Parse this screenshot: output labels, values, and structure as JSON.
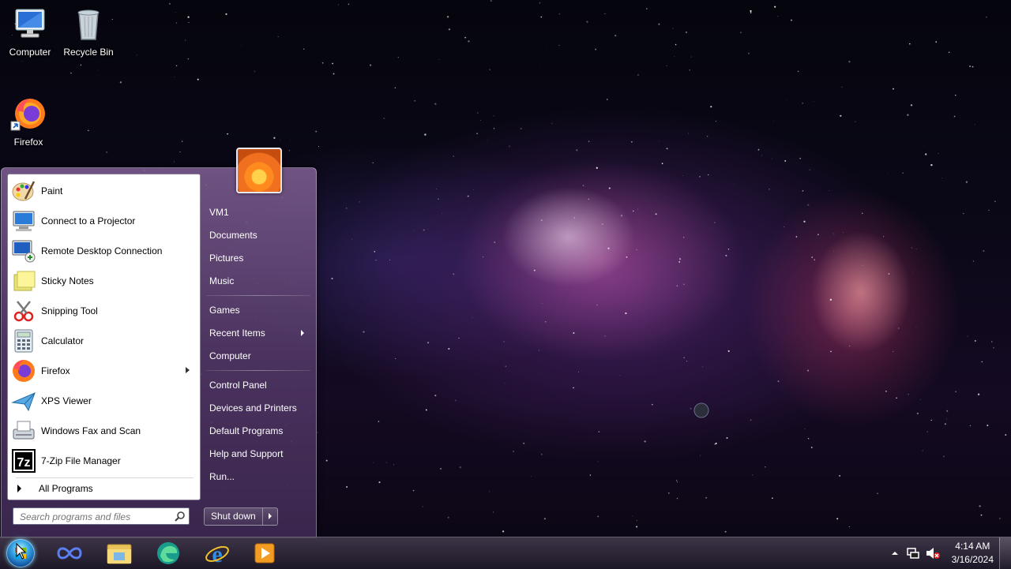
{
  "desktop": {
    "icons": [
      {
        "label": "Computer",
        "icon": "computer-icon"
      },
      {
        "label": "Recycle Bin",
        "icon": "recycle-bin-icon"
      },
      {
        "label": "Firefox",
        "icon": "firefox-icon"
      }
    ]
  },
  "start_menu": {
    "programs": [
      {
        "label": "Paint",
        "icon": "paint-icon"
      },
      {
        "label": "Connect to a Projector",
        "icon": "projector-icon"
      },
      {
        "label": "Remote Desktop Connection",
        "icon": "remote-desktop-icon"
      },
      {
        "label": "Sticky Notes",
        "icon": "sticky-notes-icon"
      },
      {
        "label": "Snipping Tool",
        "icon": "snipping-tool-icon"
      },
      {
        "label": "Calculator",
        "icon": "calculator-icon"
      },
      {
        "label": "Firefox",
        "icon": "firefox-icon",
        "has_submenu": true
      },
      {
        "label": "XPS Viewer",
        "icon": "xps-viewer-icon"
      },
      {
        "label": "Windows Fax and Scan",
        "icon": "fax-scan-icon"
      },
      {
        "label": "7-Zip File Manager",
        "icon": "7zip-icon",
        "icon_text": "7z"
      }
    ],
    "all_programs_label": "All Programs",
    "search_placeholder": "Search programs and files",
    "right_items": {
      "user": "VM1",
      "documents": "Documents",
      "pictures": "Pictures",
      "music": "Music",
      "games": "Games",
      "recent_items": "Recent Items",
      "computer": "Computer",
      "control_panel": "Control Panel",
      "devices_printers": "Devices and Printers",
      "default_programs": "Default Programs",
      "help_support": "Help and Support",
      "run": "Run..."
    },
    "shutdown_label": "Shut down"
  },
  "taskbar": {
    "pinned": [
      "infinity-app-icon",
      "file-explorer-icon",
      "edge-icon",
      "internet-explorer-icon",
      "media-player-icon"
    ],
    "clock_time": "4:14 AM",
    "clock_date": "3/16/2024",
    "tray_icons": [
      "show-hidden-icons-arrow",
      "network-icon",
      "volume-muted-icon"
    ]
  },
  "colors": {
    "accent": "#6b4f85",
    "taskbar": "#2a2333"
  }
}
